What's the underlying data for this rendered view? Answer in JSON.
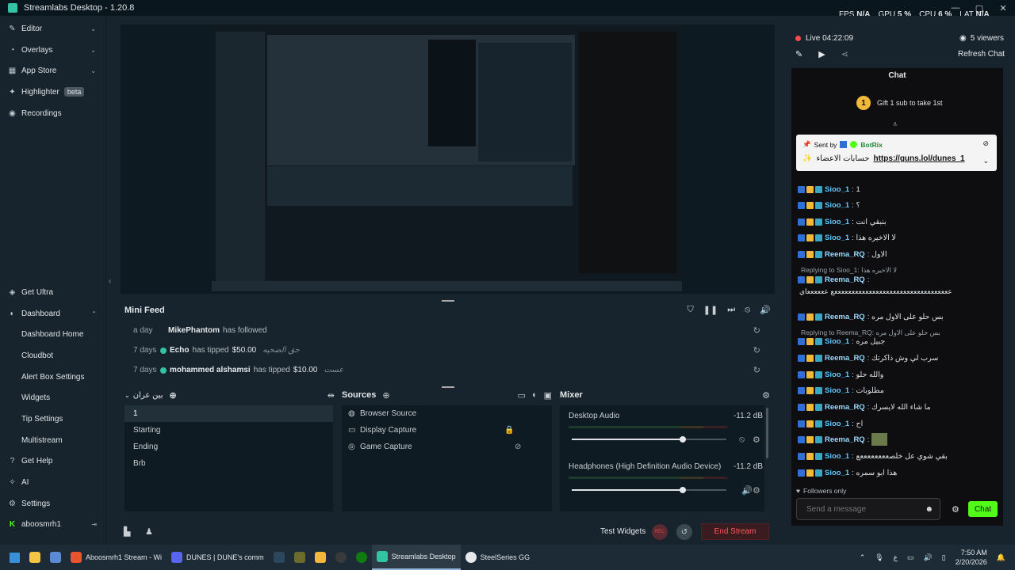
{
  "window": {
    "title": "Streamlabs Desktop - 1.20.8",
    "minimize": "—",
    "maximize": "▢",
    "close": "✕"
  },
  "stats": {
    "fps_label": "FPS",
    "fps": "N/A",
    "gpu_label": "GPU",
    "gpu": "5 %",
    "cpu_label": "CPU",
    "cpu": "6 %",
    "lat_label": "LAT",
    "lat": "N/A"
  },
  "sidebar": {
    "top": [
      {
        "label": "Editor",
        "icon": "editor-icon"
      },
      {
        "label": "Overlays",
        "icon": "overlays-icon"
      },
      {
        "label": "App Store",
        "icon": "appstore-icon"
      },
      {
        "label": "Highlighter",
        "icon": "highlighter-icon",
        "badge": "beta"
      },
      {
        "label": "Recordings",
        "icon": "recordings-icon"
      }
    ],
    "bottom": {
      "get_ultra": "Get Ultra",
      "dashboard": "Dashboard",
      "dashboard_items": [
        "Dashboard Home",
        "Cloudbot",
        "Alert Box Settings",
        "Widgets",
        "Tip Settings",
        "Multistream"
      ],
      "get_help": "Get Help",
      "ai": "AI",
      "settings": "Settings",
      "user": "aboosmrh1"
    }
  },
  "mini_feed": {
    "title": "Mini Feed",
    "rows": [
      {
        "when": "a day",
        "name": "MikePhantom",
        "action": "has followed",
        "amount": "",
        "message": ""
      },
      {
        "when": "7 days",
        "name": "Echo",
        "action": "has tipped",
        "amount": "$50.00",
        "message": "حق الضحيه"
      },
      {
        "when": "7 days",
        "name": "mohammed alshamsi",
        "action": "has tipped",
        "amount": "$10.00",
        "message": "عست"
      }
    ]
  },
  "scenes": {
    "title": "بين عران",
    "items": [
      "1",
      "Starting",
      "Ending",
      "Brb"
    ],
    "selected": "1"
  },
  "sources": {
    "title": "Sources",
    "items": [
      {
        "label": "Browser Source",
        "icon": "globe-icon"
      },
      {
        "label": "Display Capture",
        "icon": "monitor-icon"
      },
      {
        "label": "Game Capture",
        "icon": "gamepad-icon"
      }
    ]
  },
  "mixer": {
    "title": "Mixer",
    "channels": [
      {
        "label": "Desktop Audio",
        "db": "-11.2 dB",
        "level": 0.72
      },
      {
        "label": "Headphones (High Definition Audio Device)",
        "db": "-11.2 dB",
        "level": 0.72
      }
    ]
  },
  "bottom": {
    "test_widgets": "Test Widgets",
    "end_stream": "End Stream",
    "rec": "REC"
  },
  "live": {
    "status": "Live 04:22:09",
    "viewers": "5 viewers",
    "refresh": "Refresh Chat"
  },
  "chat": {
    "title": "Chat",
    "gift": "Gift 1 sub to take 1st",
    "gift_rank": "1",
    "pinned_by": "Sent by",
    "pinned_user": "BotRix",
    "pinned_text": "حسابات الاعضاء",
    "pinned_link": "https://guns.lol/dunes_1",
    "messages": [
      {
        "user": "Sioo_1",
        "text": "1"
      },
      {
        "user": "Sioo_1",
        "text": "؟"
      },
      {
        "user": "Sioo_1",
        "text": "بنبقي انت"
      },
      {
        "user": "Sioo_1",
        "text": "لا الاخيره هذا"
      },
      {
        "user": "Reema_RQ",
        "text": "الاول"
      }
    ],
    "reply1": "Replying to Sioo_1: لا الاخيره هذا",
    "reema_long_user": "Reema_RQ",
    "reema_long_text": "ععععععععععععععععععععععععععععععععععع ععععععاي",
    "msg_after1": {
      "user": "Reema_RQ",
      "text": "بس حلو على الاول مره"
    },
    "reply2": "Replying to Reema_RQ: بس حلو على الاول مره",
    "messages2": [
      {
        "user": "Sioo_1",
        "text": "جبيل مره"
      },
      {
        "user": "Reema_RQ",
        "text": "سرب لي وش ذاكرتك"
      },
      {
        "user": "Sioo_1",
        "text": "والله حلو"
      },
      {
        "user": "Sioo_1",
        "text": "مطلوبات"
      },
      {
        "user": "Reema_RQ",
        "text": "ما شاء الله لايسرك"
      },
      {
        "user": "Sioo_1",
        "text": "اح"
      },
      {
        "user": "Reema_RQ",
        "text": ""
      },
      {
        "user": "Sioo_1",
        "text": "بقي شوي عل خلصععععععععع"
      },
      {
        "user": "Sioo_1",
        "text": "هذا ابو سمره"
      }
    ],
    "followers_only": "Followers only",
    "placeholder": "Send a message",
    "send": "Chat"
  },
  "taskbar": {
    "items": [
      {
        "label": "Aboosmrh1 Stream - Wi",
        "icon": "brave-icon",
        "color": "#e9542e"
      },
      {
        "label": "DUNES | DUNE's comm",
        "icon": "discord-icon",
        "color": "#5865f2"
      },
      {
        "label": "Streamlabs Desktop",
        "icon": "streamlabs-icon",
        "color": "#31c3a2"
      },
      {
        "label": "SteelSeries GG",
        "icon": "steelseries-icon",
        "color": "#e6e9eb"
      }
    ],
    "time": "7:50 AM",
    "date": "2/20/2026"
  }
}
